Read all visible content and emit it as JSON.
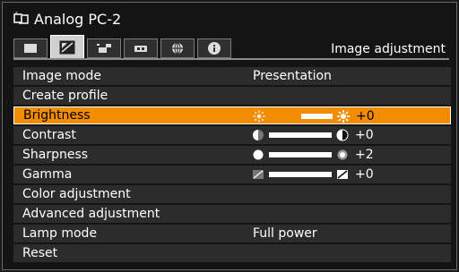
{
  "header": {
    "title": "Analog PC-2"
  },
  "tabs": [
    {
      "name": "screen",
      "icon": "screen-icon"
    },
    {
      "name": "image",
      "icon": "image-adjust-icon"
    },
    {
      "name": "install",
      "icon": "install-icon"
    },
    {
      "name": "system",
      "icon": "system-icon"
    },
    {
      "name": "network",
      "icon": "network-icon"
    },
    {
      "name": "info",
      "icon": "info-icon"
    }
  ],
  "section_title": "Image adjustment",
  "menu": {
    "image_mode": {
      "label": "Image mode",
      "value": "Presentation"
    },
    "create_profile": {
      "label": "Create profile"
    },
    "brightness": {
      "label": "Brightness",
      "value": "+0",
      "level": 0.5
    },
    "contrast": {
      "label": "Contrast",
      "value": "+0",
      "level": 0.5
    },
    "sharpness": {
      "label": "Sharpness",
      "value": "+2",
      "level": 0.6
    },
    "gamma": {
      "label": "Gamma",
      "value": "+0",
      "level": 0.5
    },
    "color_adjustment": {
      "label": "Color adjustment"
    },
    "advanced_adjustment": {
      "label": "Advanced adjustment"
    },
    "lamp_mode": {
      "label": "Lamp mode",
      "value": "Full power"
    },
    "reset": {
      "label": "Reset"
    }
  },
  "colors": {
    "selected": "#f28c00",
    "row_bg": "#2c2c2c",
    "background": "#141414"
  }
}
